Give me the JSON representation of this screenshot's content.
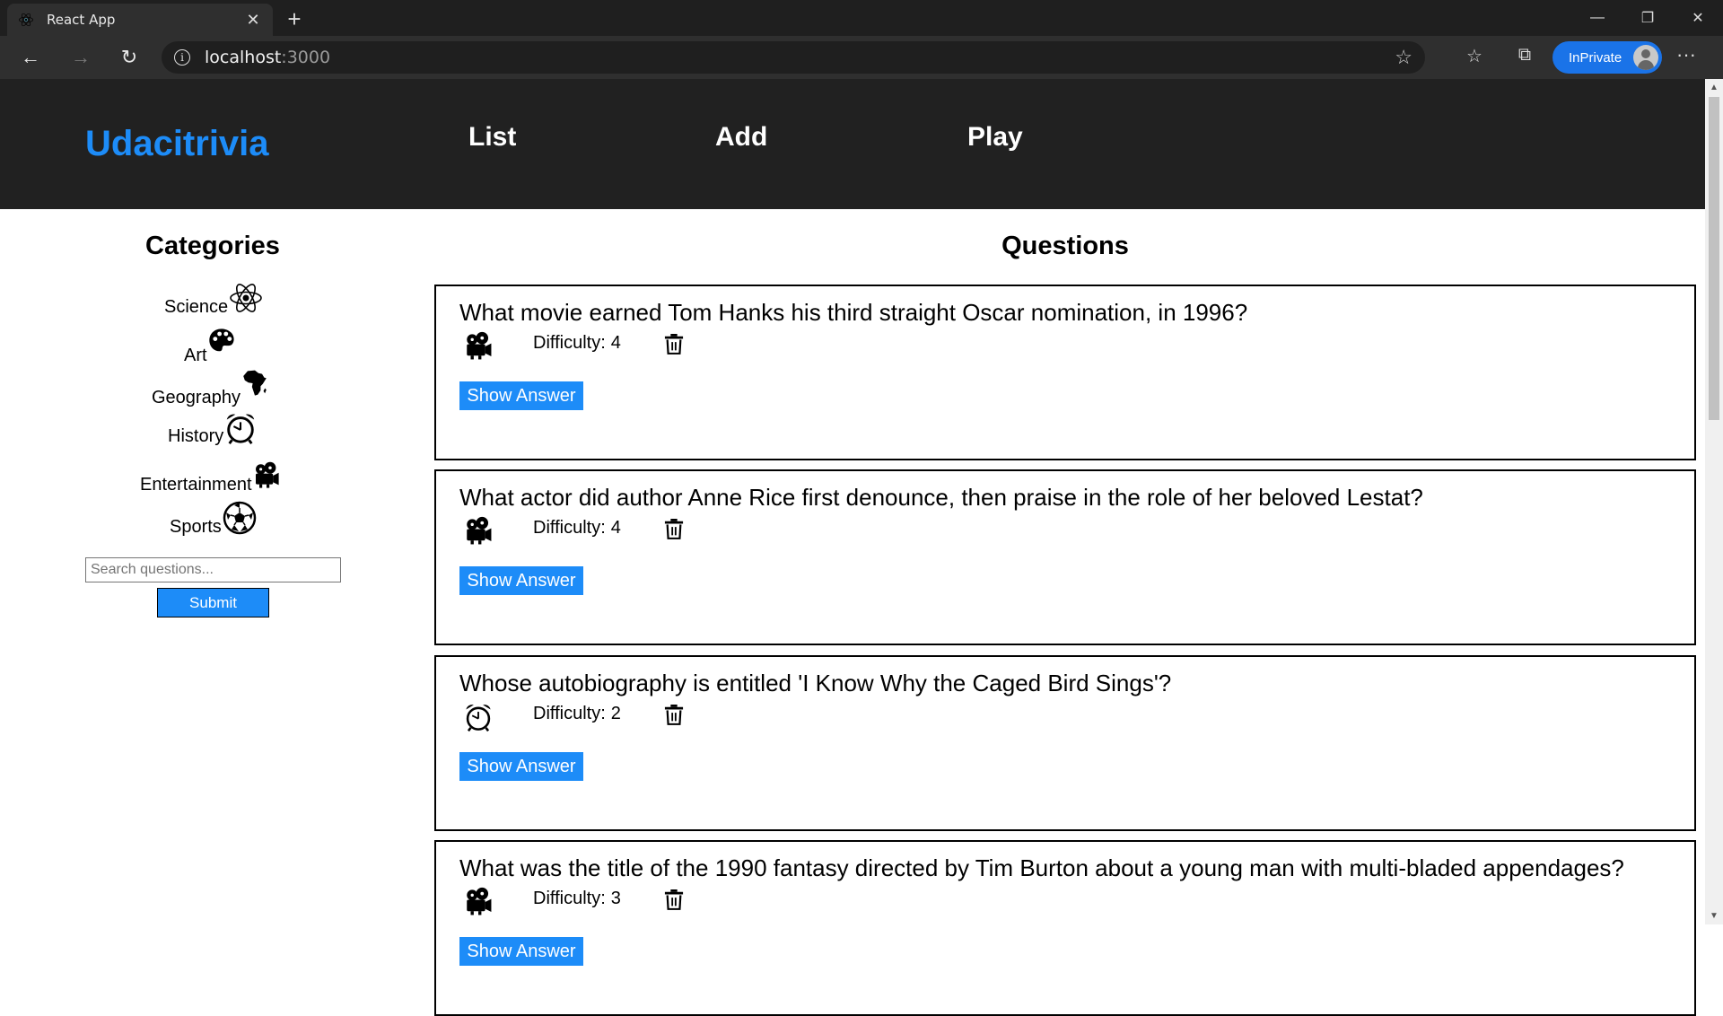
{
  "browser": {
    "tab_title": "React App",
    "url_host": "localhost",
    "url_port": ":3000",
    "inprivate_label": "InPrivate"
  },
  "app": {
    "brand": "Udacitrivia",
    "nav": [
      "List",
      "Add",
      "Play"
    ]
  },
  "categories": {
    "heading": "Categories",
    "items": [
      {
        "label": "Science",
        "icon": "science-atom-icon"
      },
      {
        "label": "Art",
        "icon": "art-palette-icon"
      },
      {
        "label": "Geography",
        "icon": "geography-africa-icon"
      },
      {
        "label": "History",
        "icon": "history-clock-icon"
      },
      {
        "label": "Entertainment",
        "icon": "entertainment-projector-icon"
      },
      {
        "label": "Sports",
        "icon": "sports-ball-icon"
      }
    ],
    "search_placeholder": "Search questions...",
    "submit_label": "Submit"
  },
  "questions": {
    "heading": "Questions",
    "difficulty_label": "Difficulty:",
    "show_answer_label": "Show Answer",
    "items": [
      {
        "text": "What movie earned Tom Hanks his third straight Oscar nomination, in 1996?",
        "difficulty": "4",
        "category": "entertainment-projector-icon"
      },
      {
        "text": "What actor did author Anne Rice first denounce, then praise in the role of her beloved Lestat?",
        "difficulty": "4",
        "category": "entertainment-projector-icon"
      },
      {
        "text": "Whose autobiography is entitled 'I Know Why the Caged Bird Sings'?",
        "difficulty": "2",
        "category": "history-clock-icon"
      },
      {
        "text": "What was the title of the 1990 fantasy directed by Tim Burton about a young man with multi-bladed appendages?",
        "difficulty": "3",
        "category": "entertainment-projector-icon"
      }
    ]
  }
}
